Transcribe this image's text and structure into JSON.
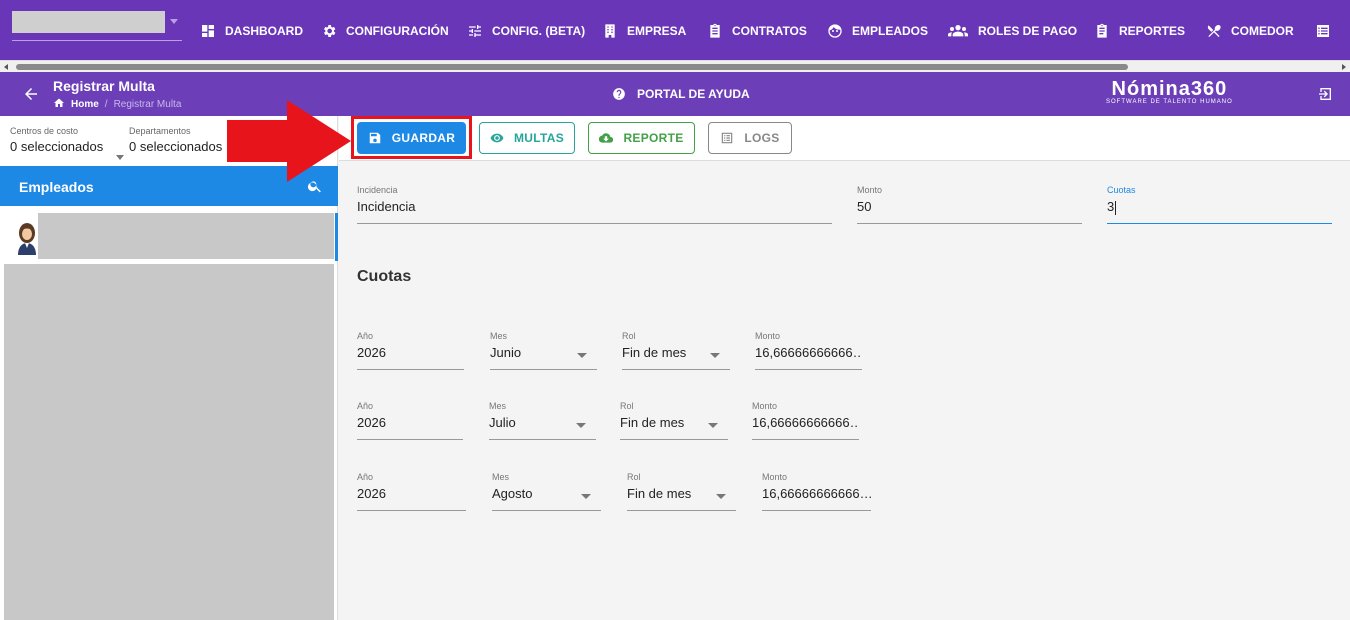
{
  "nav": {
    "items": [
      {
        "label": "DASHBOARD",
        "icon": "dashboard-icon"
      },
      {
        "label": "CONFIGURACIÓN",
        "icon": "gear-icon"
      },
      {
        "label": "CONFIG. (BETA)",
        "icon": "sliders-icon"
      },
      {
        "label": "EMPRESA",
        "icon": "building-icon"
      },
      {
        "label": "CONTRATOS",
        "icon": "clipboard-icon"
      },
      {
        "label": "EMPLEADOS",
        "icon": "face-icon"
      },
      {
        "label": "ROLES DE PAGO",
        "icon": "people-icon"
      },
      {
        "label": "REPORTES",
        "icon": "report-icon"
      },
      {
        "label": "COMEDOR",
        "icon": "utensils-icon"
      }
    ]
  },
  "header": {
    "title": "Registrar Multa",
    "breadcrumb_home": "Home",
    "breadcrumb_sep": "/",
    "breadcrumb_current": "Registrar Multa",
    "help_label": "PORTAL DE AYUDA",
    "logo_main": "Nómina360",
    "logo_sub": "SOFTWARE DE TALENTO HUMANO"
  },
  "filters": {
    "cost_centers_label": "Centros de costo",
    "cost_centers_value": "0 seleccionados",
    "departments_label": "Departamentos",
    "departments_value": "0 seleccionados"
  },
  "employees": {
    "title": "Empleados"
  },
  "toolbar": {
    "save_label": "GUARDAR",
    "multas_label": "MULTAS",
    "report_label": "REPORTE",
    "logs_label": "LOGS"
  },
  "form": {
    "incidencia_label": "Incidencia",
    "incidencia_value": "Incidencia",
    "monto_label": "Monto",
    "monto_value": "50",
    "cuotas_label": "Cuotas",
    "cuotas_value": "3"
  },
  "cuotas": {
    "title": "Cuotas",
    "labels": {
      "year": "Año",
      "month": "Mes",
      "rol": "Rol",
      "amount": "Monto"
    },
    "rows": [
      {
        "year": "2026",
        "month": "Junio",
        "rol": "Fin de mes",
        "amount": "16,66666666666…"
      },
      {
        "year": "2026",
        "month": "Julio",
        "rol": "Fin de mes",
        "amount": "16,66666666666…"
      },
      {
        "year": "2026",
        "month": "Agosto",
        "rol": "Fin de mes",
        "amount": "16,66666666666…"
      }
    ]
  },
  "colors": {
    "nav_bg": "#6a36b8",
    "primary": "#1e88e5",
    "multas": "#26a69a",
    "reporte": "#43a047",
    "highlight": "#e8141b"
  }
}
